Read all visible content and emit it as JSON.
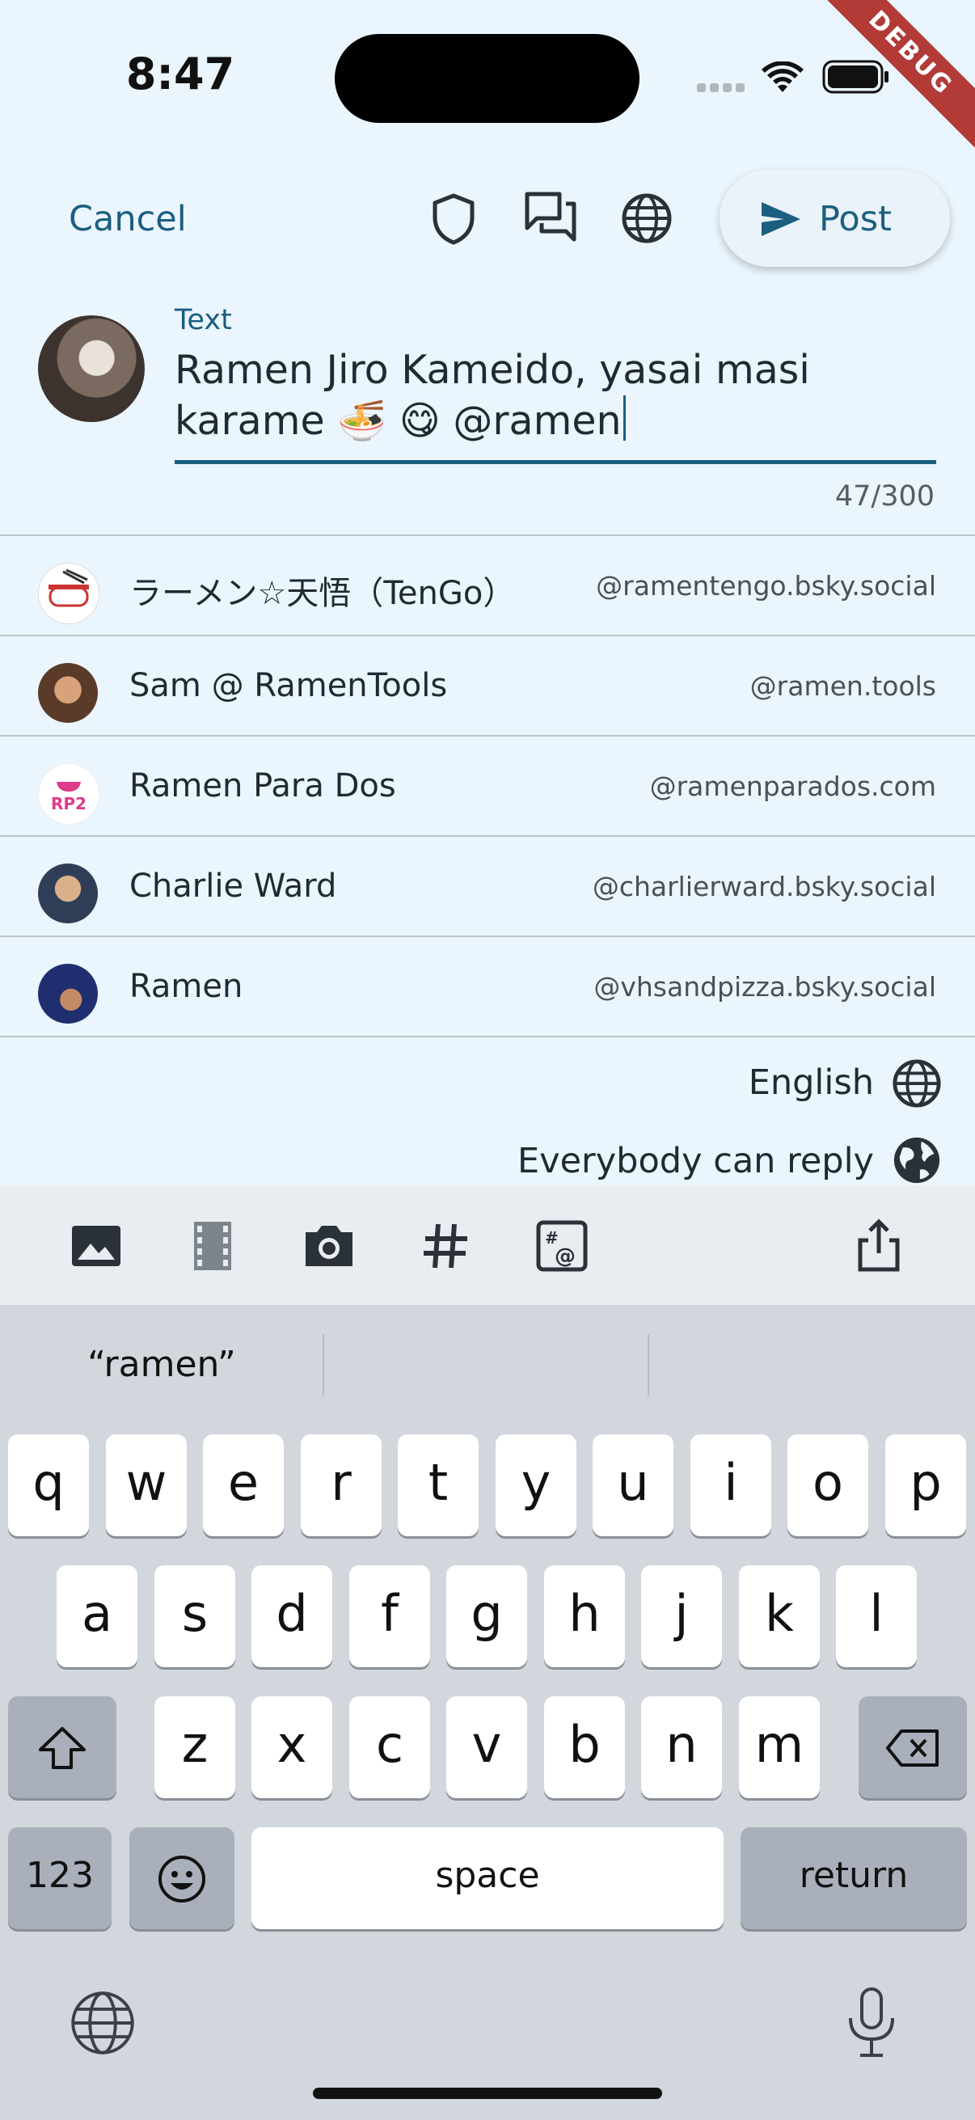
{
  "status_bar": {
    "time": "8:47",
    "debug_banner": "DEBUG"
  },
  "app_bar": {
    "cancel": "Cancel",
    "post": "Post"
  },
  "composer": {
    "label": "Text",
    "line1": "Ramen Jiro Kameido, yasai masi",
    "line2": "karame 🍜 😋  @ramen",
    "counter": "47/300"
  },
  "suggestions": [
    {
      "name": "ラーメン☆天悟（TenGo）",
      "handle": "@ramentengo.bsky.social"
    },
    {
      "name": "Sam @ RamenTools",
      "handle": "@ramen.tools"
    },
    {
      "name": "Ramen Para Dos",
      "handle": "@ramenparados.com"
    },
    {
      "name": "Charlie Ward",
      "handle": "@charlierward.bsky.social"
    },
    {
      "name": "Ramen",
      "handle": "@vhsandpizza.bsky.social"
    }
  ],
  "avatar_text": {
    "rp2": "RP2"
  },
  "settings": {
    "language": "English",
    "reply": "Everybody can reply"
  },
  "keyboard": {
    "suggestion": "“ramen”",
    "row1": [
      "q",
      "w",
      "e",
      "r",
      "t",
      "y",
      "u",
      "i",
      "o",
      "p"
    ],
    "row2": [
      "a",
      "s",
      "d",
      "f",
      "g",
      "h",
      "j",
      "k",
      "l"
    ],
    "row3": [
      "z",
      "x",
      "c",
      "v",
      "b",
      "n",
      "m"
    ],
    "numbers": "123",
    "space": "space",
    "return": "return"
  },
  "colors": {
    "accent": "#1b5e80",
    "background": "#eaf5fd",
    "keyboard": "#d2d6dd"
  }
}
